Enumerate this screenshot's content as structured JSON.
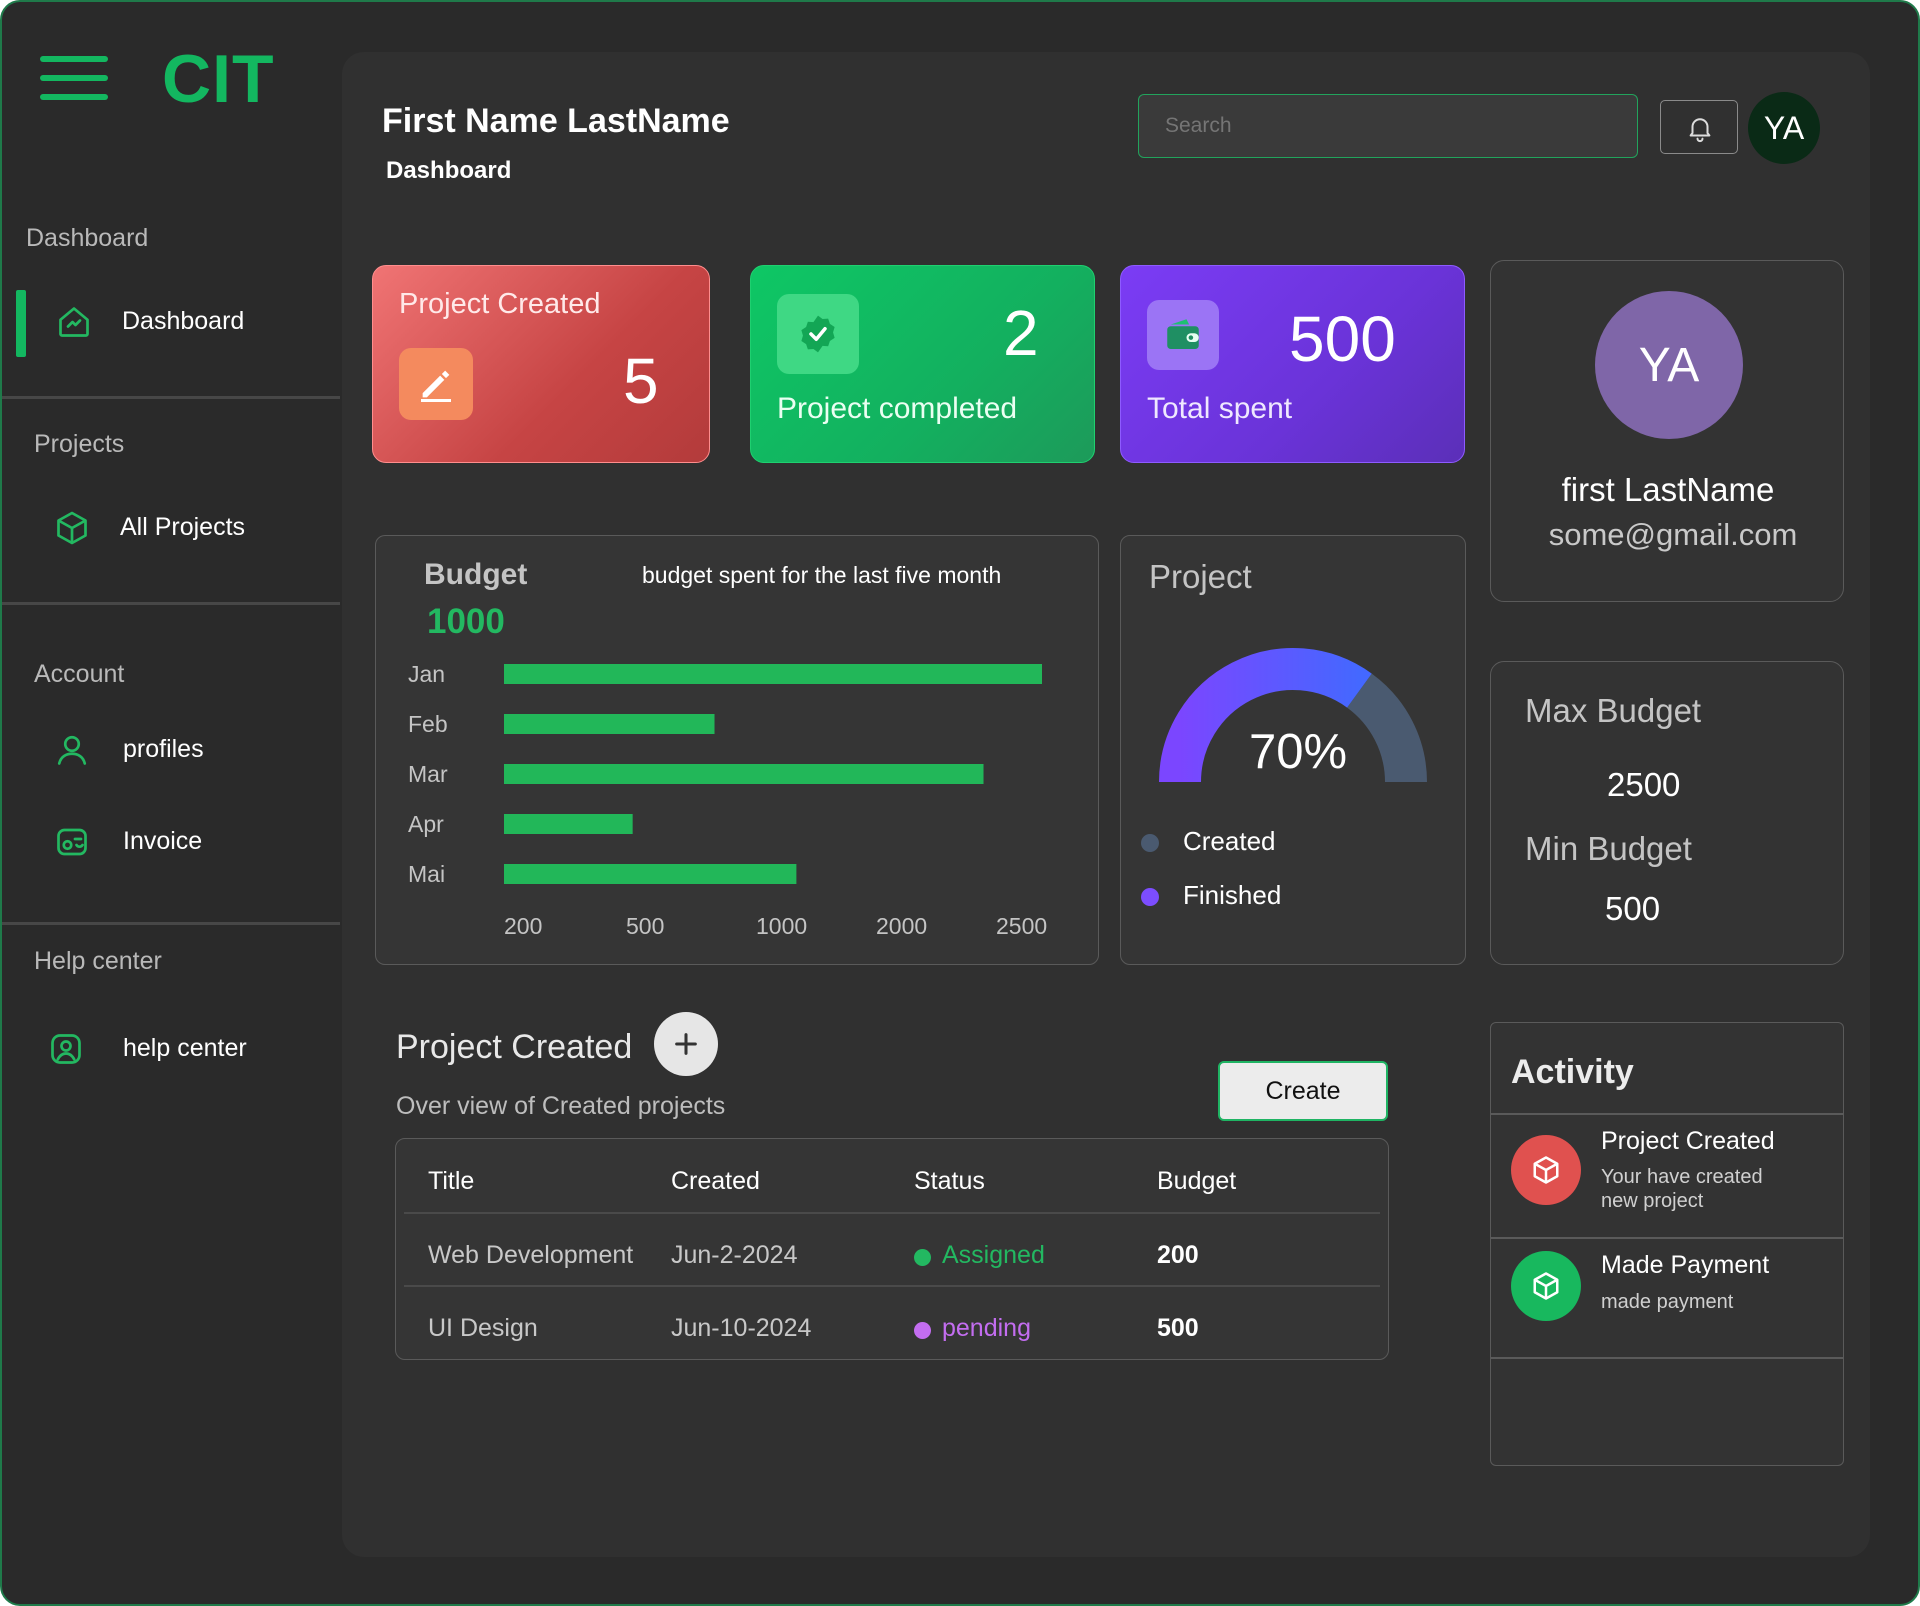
{
  "colors": {
    "accent": "#13b760",
    "bg": "#2a2a2a",
    "panel": "#353535"
  },
  "app": {
    "logo": "CIT"
  },
  "sidebar": {
    "sections": [
      {
        "title": "Dashboard",
        "items": [
          {
            "label": "Dashboard",
            "icon": "home-chart-icon",
            "active": true
          }
        ]
      },
      {
        "title": "Projects",
        "items": [
          {
            "label": "All Projects",
            "icon": "cube-icon"
          }
        ]
      },
      {
        "title": "Account",
        "items": [
          {
            "label": "profiles",
            "icon": "user-icon"
          },
          {
            "label": "Invoice",
            "icon": "invoice-icon"
          }
        ]
      },
      {
        "title": "Help center",
        "items": [
          {
            "label": "help center",
            "icon": "help-user-icon"
          }
        ]
      }
    ]
  },
  "header": {
    "user_name": "First Name LastName",
    "breadcrumb": "Dashboard",
    "search_placeholder": "Search",
    "avatar_initials": "YA"
  },
  "stats": {
    "created": {
      "label": "Project Created",
      "value": "5",
      "icon": "edit-icon"
    },
    "completed": {
      "label": "Project completed",
      "value": "2",
      "icon": "verified-icon"
    },
    "spent": {
      "label": "Total spent",
      "value": "500",
      "icon": "wallet-icon"
    }
  },
  "profile_card": {
    "initials": "YA",
    "name": "first LastName",
    "email": "some@gmail.com"
  },
  "chart_data": [
    {
      "type": "bar",
      "title": "Budget",
      "subtitle": "budget spent for the last five month",
      "headline_value": "1000",
      "orientation": "horizontal",
      "categories": [
        "Jan",
        "Feb",
        "Mar",
        "Apr",
        "Mai"
      ],
      "values": [
        2500,
        1100,
        2250,
        750,
        1450
      ],
      "x_ticks": [
        "200",
        "500",
        "1000",
        "2000",
        "2500"
      ],
      "xlim": [
        200,
        2500
      ],
      "color": "#22b759"
    },
    {
      "type": "pie",
      "title": "Project",
      "center_label": "70%",
      "series": [
        {
          "name": "Created",
          "value": 30,
          "color": "#4a5a70"
        },
        {
          "name": "Finished",
          "value": 70,
          "color": "#7c4dff"
        }
      ]
    }
  ],
  "budget_limits": {
    "max_label": "Max Budget",
    "max_value": "2500",
    "min_label": "Min Budget",
    "min_value": "500"
  },
  "projects": {
    "title": "Project Created",
    "subtitle": "Over view of Created projects",
    "create_label": "Create",
    "columns": [
      "Title",
      "Created",
      "Status",
      "Budget"
    ],
    "rows": [
      {
        "title": "Web Development",
        "created": "Jun-2-2024",
        "status": "Assigned",
        "status_color": "#23b861",
        "budget": "200"
      },
      {
        "title": "UI Design",
        "created": "Jun-10-2024",
        "status": "pending",
        "status_color": "#c36df0",
        "budget": "500"
      }
    ]
  },
  "activity": {
    "title": "Activity",
    "items": [
      {
        "title": "Project Created",
        "desc": "Your have created new project",
        "icon": "cube-icon",
        "color": "#e0514f"
      },
      {
        "title": "Made Payment",
        "desc": "made payment",
        "icon": "cube-icon",
        "color": "#18b85e"
      }
    ]
  }
}
